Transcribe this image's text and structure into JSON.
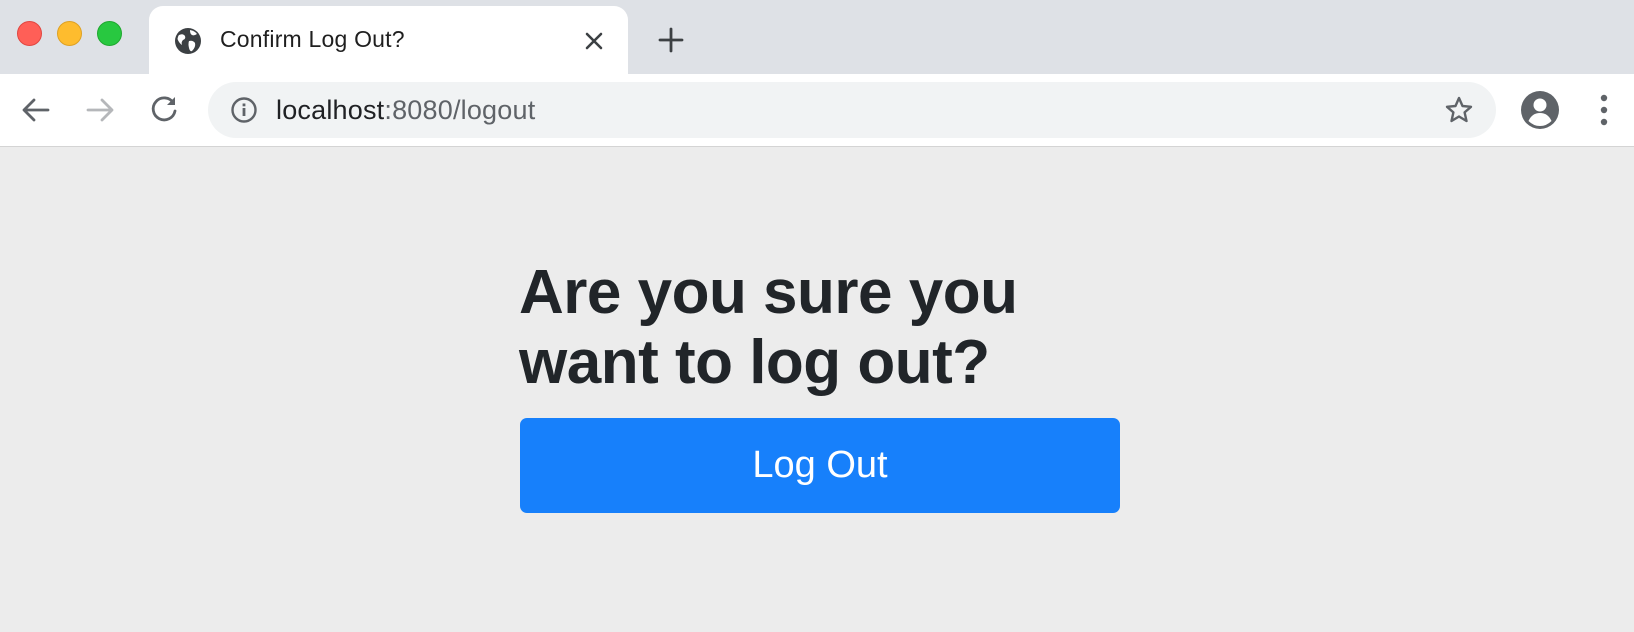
{
  "browser": {
    "tab": {
      "title": "Confirm Log Out?",
      "favicon": "globe-icon"
    },
    "address_bar": {
      "host": "localhost",
      "rest": ":8080/logout"
    },
    "icons": {
      "back": "arrow-left-icon",
      "forward": "arrow-right-icon",
      "reload": "reload-icon",
      "site_info": "info-icon",
      "bookmark": "star-icon",
      "profile": "profile-icon",
      "menu": "kebab-menu-icon",
      "new_tab": "plus-icon",
      "close_tab": "close-icon"
    },
    "traffic_lights": {
      "close": "#ff5f57",
      "minimize": "#febc2e",
      "maximize": "#28c840"
    }
  },
  "page": {
    "heading": "Are you sure you want to log out?",
    "logout_button_label": "Log Out"
  },
  "colors": {
    "accent": "#1780fb",
    "page_background": "#ececec",
    "heading_text": "#212529"
  }
}
